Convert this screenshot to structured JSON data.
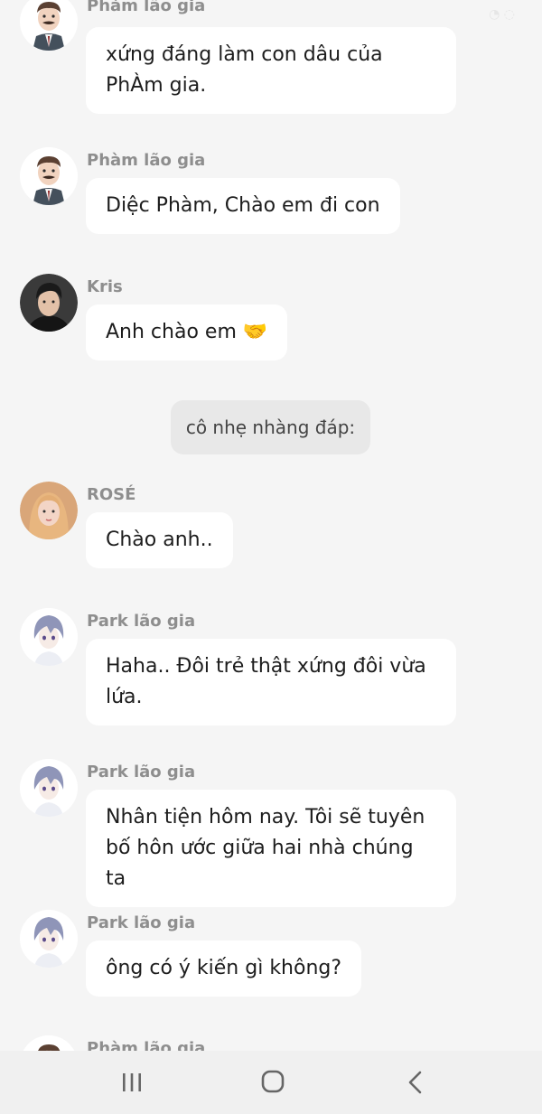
{
  "messages": [
    {
      "sender": "Phàm lão gia",
      "avatar": "old-man-mustache-avatar",
      "text": "xứng đáng làm con dâu của PhÀm gia."
    },
    {
      "sender": "Phàm lão gia",
      "avatar": "old-man-mustache-avatar",
      "text": "Diệc Phàm, Chào em đi con"
    },
    {
      "sender": "Kris",
      "avatar": "young-man-photo-avatar",
      "text": "Anh chào em 🤝"
    },
    {
      "type": "narration",
      "text": "cô nhẹ nhàng đáp:"
    },
    {
      "sender": "ROSÉ",
      "avatar": "blonde-woman-photo-avatar",
      "text": "Chào anh.."
    },
    {
      "sender": "Park lão gia",
      "avatar": "silver-hair-anime-avatar",
      "text": "Haha.. Đôi trẻ thật xứng đôi vừa lứa."
    },
    {
      "sender": "Park lão gia",
      "avatar": "silver-hair-anime-avatar",
      "text": "Nhân tiện hôm nay. Tôi sẽ tuyên bố hôn ước giữa hai nhà chúng ta"
    },
    {
      "sender": "Park lão gia",
      "avatar": "silver-hair-anime-avatar",
      "text": "ông có ý kiến gì không?"
    },
    {
      "sender": "Phàm lão gia",
      "avatar": "old-man-mustache-avatar",
      "text": ""
    }
  ],
  "navbar": {
    "buttons": [
      "recent-apps-icon",
      "home-icon",
      "back-icon"
    ]
  },
  "colors": {
    "background": "#f5f5f5",
    "bubble": "#ffffff",
    "sender_text": "#8e8e8e",
    "narration_bg": "#e8e8e8",
    "navbar_bg": "#f0f0f0"
  }
}
